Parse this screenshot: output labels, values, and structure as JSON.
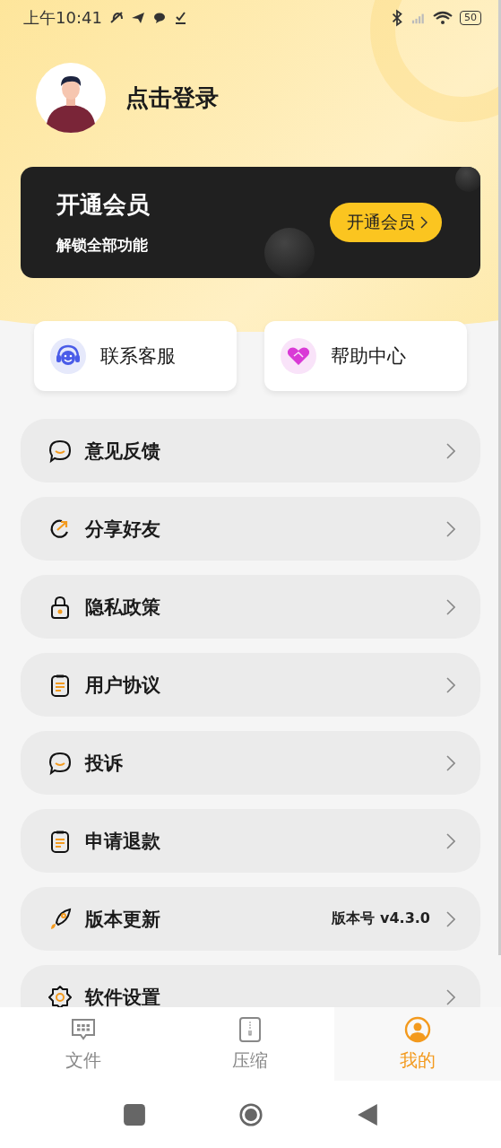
{
  "status_bar": {
    "time": "上午10:41",
    "battery": "50"
  },
  "profile": {
    "login_label": "点击登录"
  },
  "member_card": {
    "title": "开通会员",
    "subtitle": "解锁全部功能",
    "button": "开通会员"
  },
  "quick_actions": [
    {
      "kind": "service",
      "label": "联系客服"
    },
    {
      "kind": "help",
      "label": "帮助中心"
    }
  ],
  "menu": [
    {
      "kind": "chat",
      "label": "意见反馈"
    },
    {
      "kind": "share",
      "label": "分享好友"
    },
    {
      "kind": "lock",
      "label": "隐私政策"
    },
    {
      "kind": "document",
      "label": "用户协议"
    },
    {
      "kind": "chat",
      "label": "投诉"
    },
    {
      "kind": "document",
      "label": "申请退款"
    },
    {
      "kind": "rocket",
      "label": "版本更新",
      "value": "版本号 v4.3.0"
    },
    {
      "kind": "gear",
      "label": "软件设置"
    }
  ],
  "tabs": [
    {
      "kind": "files",
      "label": "文件",
      "selected": false
    },
    {
      "kind": "compress",
      "label": "压缩",
      "selected": false
    },
    {
      "kind": "me",
      "label": "我的",
      "selected": true
    }
  ]
}
